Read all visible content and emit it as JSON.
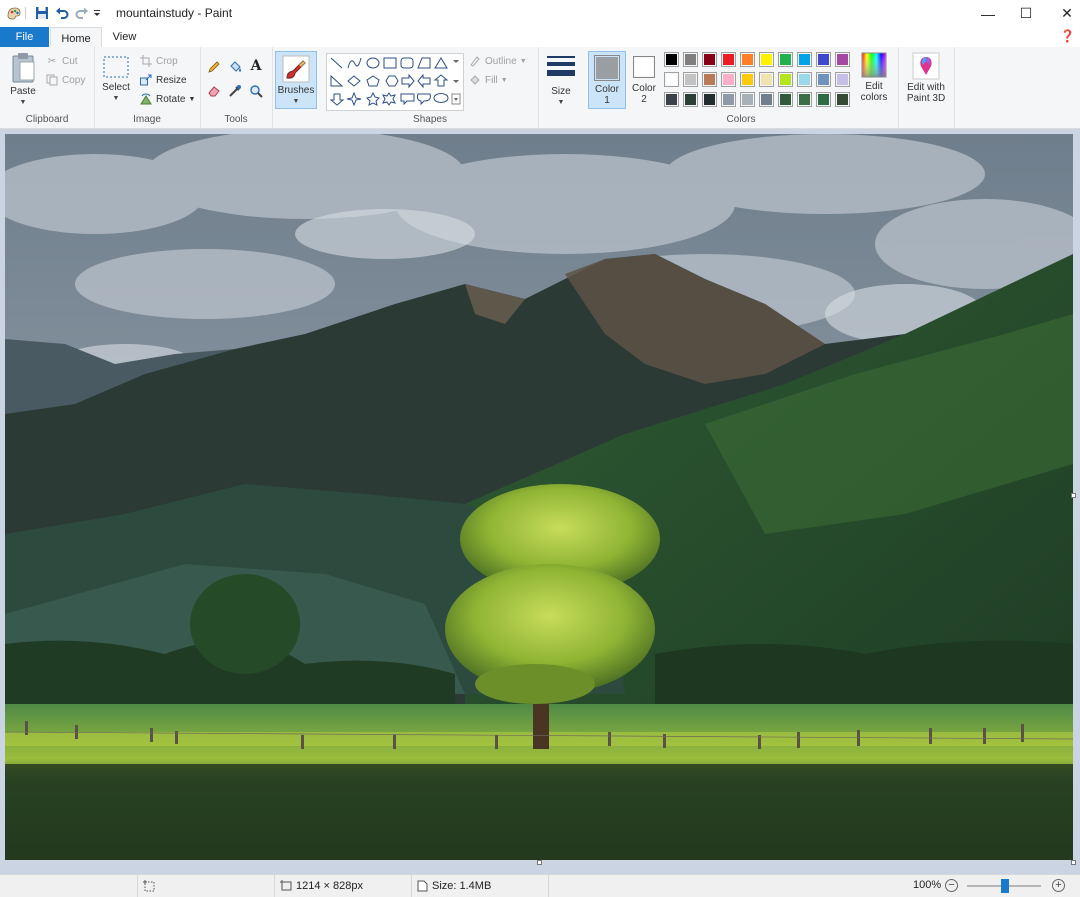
{
  "window": {
    "title": "mountainstudy - Paint"
  },
  "tabs": {
    "file": "File",
    "home": "Home",
    "view": "View"
  },
  "ribbon": {
    "clipboard": {
      "label": "Clipboard",
      "paste": "Paste",
      "cut": "Cut",
      "copy": "Copy"
    },
    "image": {
      "label": "Image",
      "select": "Select",
      "crop": "Crop",
      "resize": "Resize",
      "rotate": "Rotate"
    },
    "tools": {
      "label": "Tools"
    },
    "brushes": {
      "label": "Brushes"
    },
    "shapes": {
      "label": "Shapes",
      "outline": "Outline",
      "fill": "Fill"
    },
    "size": {
      "label": "Size"
    },
    "colors": {
      "label": "Colors",
      "color1": "Color 1",
      "color1_value": "#999ea3",
      "color2": "Color 2",
      "color2_value": "#ffffff",
      "edit_colors": "Edit colors",
      "palette_row1": [
        "#000000",
        "#7f7f7f",
        "#880015",
        "#ed1c24",
        "#ff7f27",
        "#fff200",
        "#22b14c",
        "#00a2e8",
        "#3f48cc",
        "#a349a4"
      ],
      "palette_row2": [
        "#ffffff",
        "#c3c3c3",
        "#b97a57",
        "#ffaec9",
        "#ffc90e",
        "#efe4b0",
        "#b5e61d",
        "#99d9ea",
        "#7092be",
        "#c8bfe7"
      ],
      "palette_row3": [
        "#3a4148",
        "#2b3f36",
        "#232c2e",
        "#8e9aa6",
        "#a8b0b8",
        "#6f7f8c",
        "#2f5b3c",
        "#3c6e46",
        "#2d6b45",
        "#354a34"
      ]
    },
    "paint3d": {
      "label": "Edit with Paint 3D"
    }
  },
  "status": {
    "dimensions": "1214 × 828px",
    "size": "Size: 1.4MB",
    "zoom": "100%"
  }
}
